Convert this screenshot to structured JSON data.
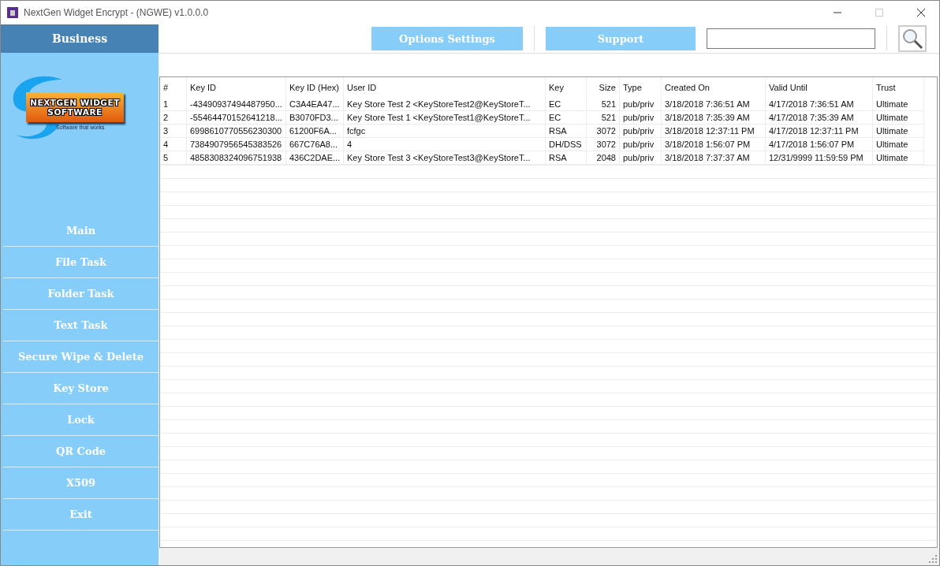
{
  "window": {
    "title": "NextGen Widget Encrypt - (NGWE) v1.0.0.0"
  },
  "sidebar": {
    "header": "Business",
    "logo": {
      "line1": "NEXTGEN WIDGET",
      "line2": "SOFTWARE",
      "tagline": "Software that works"
    },
    "items": [
      "Main",
      "File Task",
      "Folder Task",
      "Text Task",
      "Secure Wipe & Delete",
      "Key Store",
      "Lock",
      "QR Code",
      "X509",
      "Exit"
    ]
  },
  "toolbar": {
    "buttons": [
      "Options Settings",
      "Support"
    ]
  },
  "table": {
    "columns": [
      "#",
      "Key ID",
      "Key ID (Hex)",
      "User ID",
      "Key",
      "Size",
      "Type",
      "Created On",
      "Valid Until",
      "Trust"
    ],
    "rows": [
      [
        "1",
        "-43490937494487950...",
        "C3A4EA47...",
        "Key Store Test 2 <KeyStoreTest2@KeyStoreT...",
        "EC",
        "521",
        "pub/priv",
        "3/18/2018 7:36:51 AM",
        "4/17/2018 7:36:51 AM",
        "Ultimate"
      ],
      [
        "2",
        "-55464470152641218...",
        "B3070FD3...",
        "Key Store Test 1 <KeyStoreTest1@KeyStoreT...",
        "EC",
        "521",
        "pub/priv",
        "3/18/2018 7:35:39 AM",
        "4/17/2018 7:35:39 AM",
        "Ultimate"
      ],
      [
        "3",
        "6998610770556230300",
        "61200F6A...",
        "fcfgc",
        "RSA",
        "3072",
        "pub/priv",
        "3/18/2018 12:37:11 PM",
        "4/17/2018 12:37:11 PM",
        "Ultimate"
      ],
      [
        "4",
        "7384907956545383526",
        "667C76A8...",
        "4",
        "DH/DSS",
        "3072",
        "pub/priv",
        "3/18/2018 1:56:07 PM",
        "4/17/2018 1:56:07 PM",
        "Ultimate"
      ],
      [
        "5",
        "4858308324096751938",
        "436C2DAE...",
        "Key Store Test 3 <KeyStoreTest3@KeyStoreT...",
        "RSA",
        "2048",
        "pub/priv",
        "3/18/2018 7:37:37 AM",
        "12/31/9999 11:59:59 PM",
        "Ultimate"
      ]
    ]
  }
}
